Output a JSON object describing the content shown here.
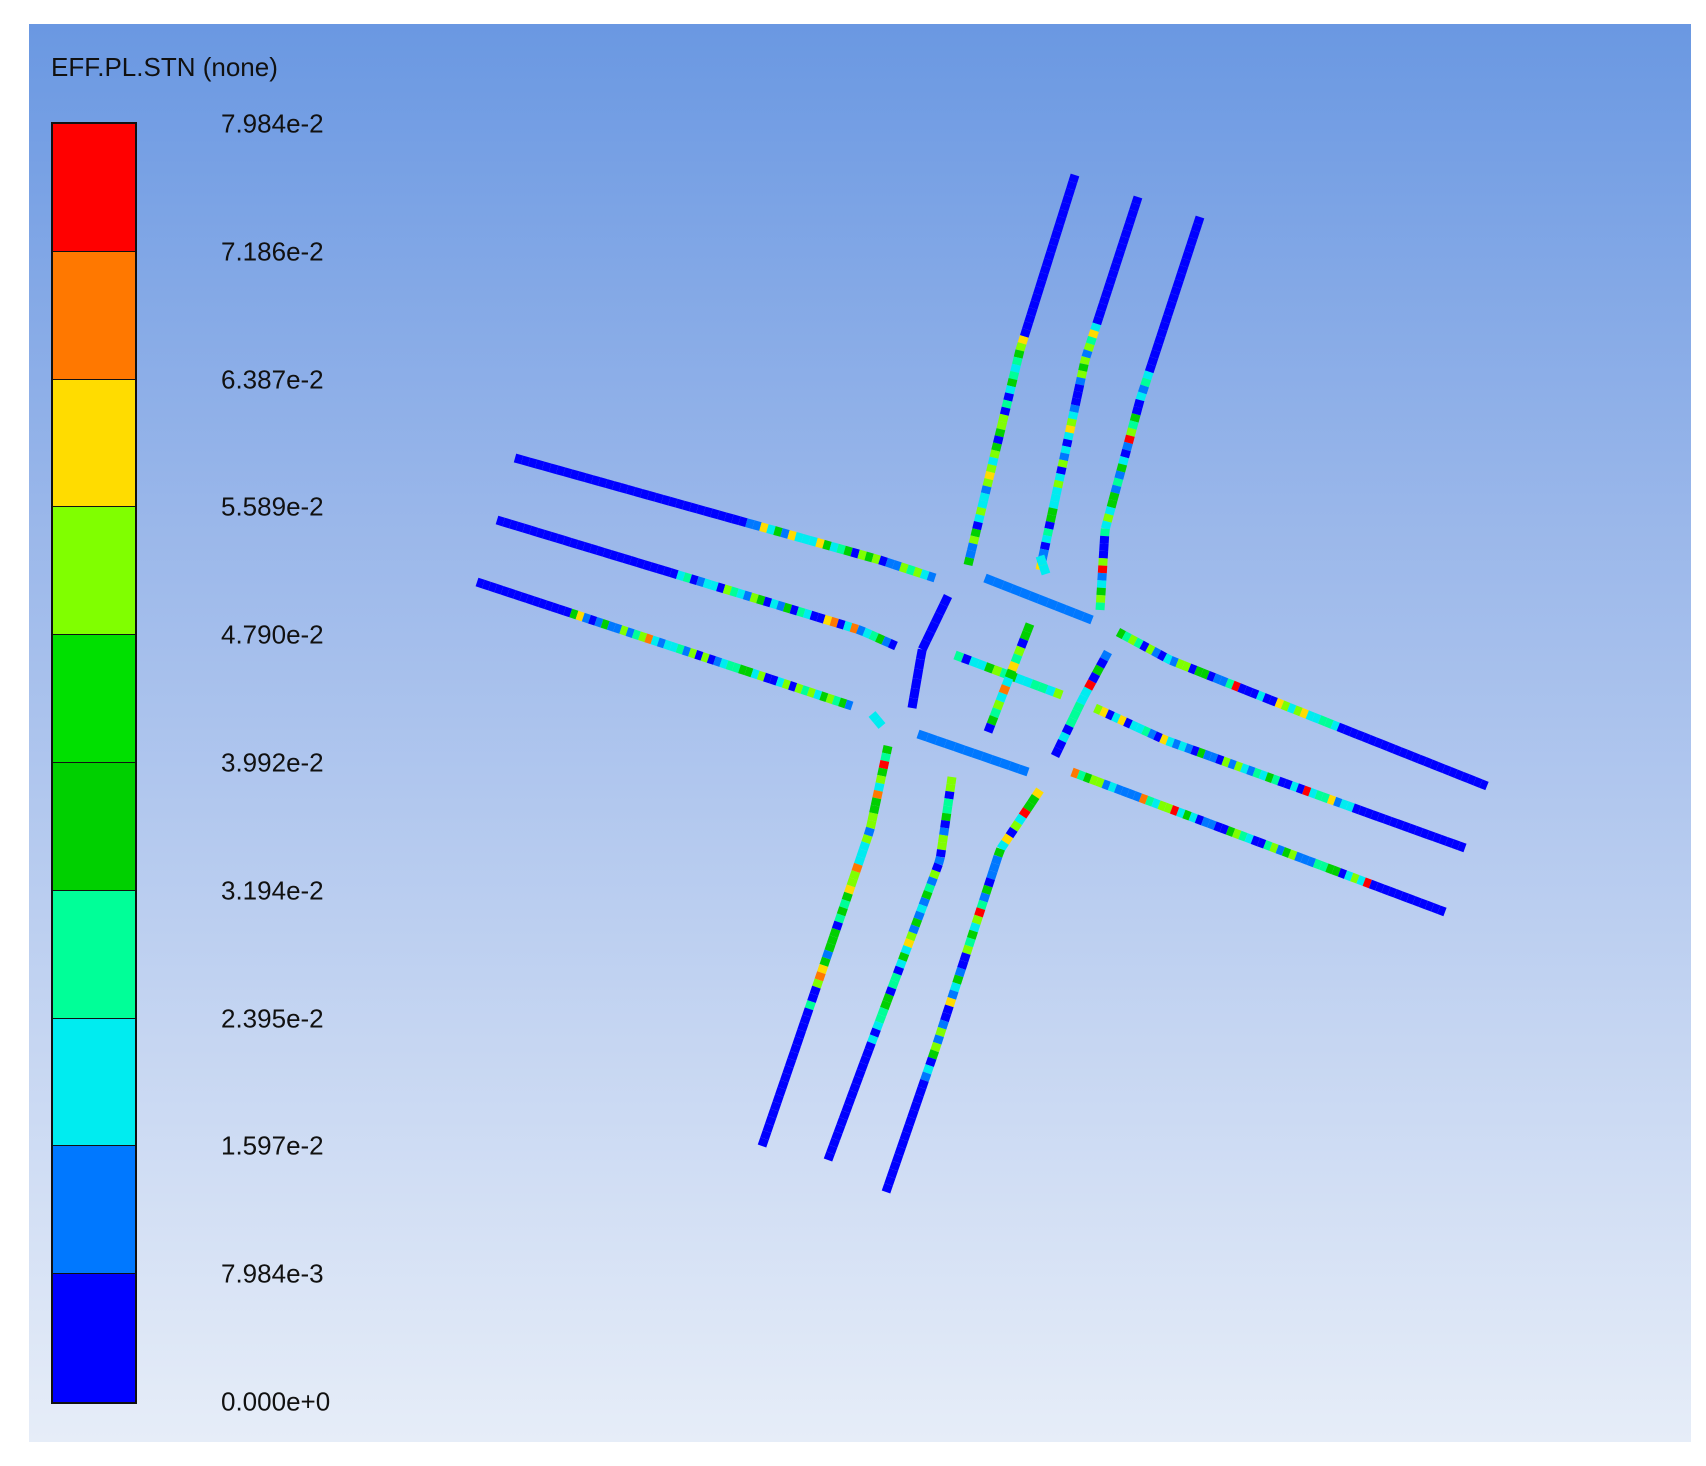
{
  "legend": {
    "title": "EFF.PL.STN (none)",
    "ticks": [
      "7.984e-2",
      "7.186e-2",
      "6.387e-2",
      "5.589e-2",
      "4.790e-2",
      "3.992e-2",
      "3.194e-2",
      "2.395e-2",
      "1.597e-2",
      "7.984e-3",
      "0.000e+0"
    ],
    "band_colors": [
      "#ff0000",
      "#ff7800",
      "#ffdc00",
      "#80ff00",
      "#00e000",
      "#00d000",
      "#00ff98",
      "#00ecf0",
      "#0078ff",
      "#0000ff"
    ]
  },
  "colors": {
    "background_top": "#6a98e2",
    "background_bottom": "#e6edf8"
  }
}
